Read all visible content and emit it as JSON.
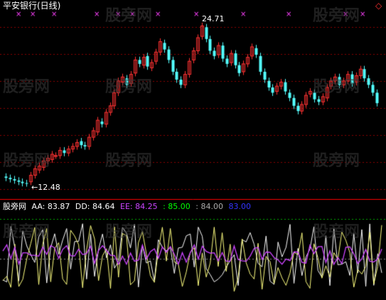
{
  "title": "平安银行(日线)",
  "price_panel": {
    "high_label": "24.71",
    "low_label": "12.48",
    "marker_glyph": "×",
    "diamond_glyph": "◇",
    "colors": {
      "up": "#ff3232",
      "down": "#54ffff",
      "grid": "#8b0000",
      "marker": "#ff40ff",
      "label": "#ffffff",
      "border": "#ff0000"
    }
  },
  "indicator": {
    "name": "股旁网",
    "items": [
      {
        "key": "AA",
        "label": "AA: 83.87",
        "color": "#ffffff"
      },
      {
        "key": "DD",
        "label": "DD: 84.64",
        "color": "#ffff80"
      },
      {
        "key": "EE",
        "label": "EE: 84.25",
        "color": "#cc44ff"
      },
      {
        "key": "L1",
        "label": ": 85.00",
        "color": "#00ff00"
      },
      {
        "key": "L2",
        "label": ": 84.00",
        "color": "#aaaaaa"
      },
      {
        "key": "L3",
        "label": "83.00",
        "color": "#3333ff"
      }
    ]
  },
  "watermark": "股旁网",
  "chart_data": {
    "type": "candlestick",
    "title": "平安银行(日线)",
    "price_range": [
      11.5,
      25.5
    ],
    "annotations": [
      {
        "text": "24.71",
        "value": 24.71
      },
      {
        "text": "12.48",
        "value": 12.48
      }
    ],
    "candles": [
      [
        13.0,
        12.9
      ],
      [
        12.9,
        12.8
      ],
      [
        12.8,
        12.7
      ],
      [
        12.7,
        12.6
      ],
      [
        12.6,
        12.5
      ],
      [
        12.5,
        12.48
      ],
      [
        12.6,
        13.1
      ],
      [
        13.1,
        13.6
      ],
      [
        13.5,
        13.8
      ],
      [
        13.7,
        14.2
      ],
      [
        14.2,
        14.4
      ],
      [
        14.3,
        14.7
      ],
      [
        14.6,
        14.6
      ],
      [
        14.6,
        15.0
      ],
      [
        15.0,
        14.8
      ],
      [
        14.8,
        15.1
      ],
      [
        15.1,
        15.3
      ],
      [
        15.3,
        15.6
      ],
      [
        15.7,
        15.4
      ],
      [
        15.4,
        15.3
      ],
      [
        15.3,
        16.0
      ],
      [
        16.0,
        16.5
      ],
      [
        16.4,
        17.3
      ],
      [
        17.2,
        17.0
      ],
      [
        17.0,
        17.9
      ],
      [
        17.9,
        18.4
      ],
      [
        18.4,
        19.4
      ],
      [
        19.4,
        20.3
      ],
      [
        20.2,
        20.6
      ],
      [
        20.5,
        20.0
      ],
      [
        20.1,
        20.8
      ],
      [
        20.9,
        21.9
      ],
      [
        21.9,
        21.6
      ],
      [
        21.5,
        22.1
      ],
      [
        22.2,
        21.4
      ],
      [
        21.3,
        21.7
      ],
      [
        21.8,
        22.5
      ],
      [
        22.5,
        23.3
      ],
      [
        23.2,
        22.7
      ],
      [
        22.7,
        21.9
      ],
      [
        21.9,
        21.0
      ],
      [
        21.0,
        20.4
      ],
      [
        20.4,
        20.0
      ],
      [
        20.0,
        20.8
      ],
      [
        20.8,
        21.8
      ],
      [
        21.9,
        22.6
      ],
      [
        22.6,
        23.6
      ],
      [
        23.7,
        24.5
      ],
      [
        24.4,
        23.5
      ],
      [
        23.5,
        22.6
      ],
      [
        22.6,
        22.2
      ],
      [
        22.3,
        23.0
      ],
      [
        23.0,
        22.0
      ],
      [
        22.0,
        21.6
      ],
      [
        21.7,
        22.4
      ],
      [
        22.4,
        21.5
      ],
      [
        21.5,
        20.9
      ],
      [
        21.0,
        21.6
      ],
      [
        21.6,
        22.1
      ],
      [
        22.2,
        22.9
      ],
      [
        22.8,
        22.3
      ],
      [
        22.2,
        21.0
      ],
      [
        21.0,
        20.4
      ],
      [
        20.3,
        19.8
      ],
      [
        19.8,
        19.4
      ],
      [
        19.5,
        19.9
      ],
      [
        19.9,
        20.2
      ],
      [
        20.2,
        19.5
      ],
      [
        19.4,
        19.0
      ],
      [
        19.0,
        18.4
      ],
      [
        18.4,
        18.0
      ],
      [
        18.0,
        18.5
      ],
      [
        18.5,
        19.2
      ],
      [
        19.3,
        19.5
      ],
      [
        19.4,
        18.9
      ],
      [
        18.9,
        18.7
      ],
      [
        18.7,
        19.1
      ],
      [
        19.0,
        19.8
      ],
      [
        19.9,
        20.3
      ],
      [
        20.3,
        20.6
      ],
      [
        20.6,
        20.0
      ],
      [
        20.0,
        20.3
      ],
      [
        20.3,
        20.8
      ],
      [
        20.8,
        20.1
      ],
      [
        20.2,
        20.7
      ],
      [
        20.7,
        21.2
      ],
      [
        21.2,
        20.5
      ],
      [
        20.5,
        20.0
      ],
      [
        20.0,
        19.4
      ],
      [
        19.4,
        18.6
      ]
    ]
  }
}
